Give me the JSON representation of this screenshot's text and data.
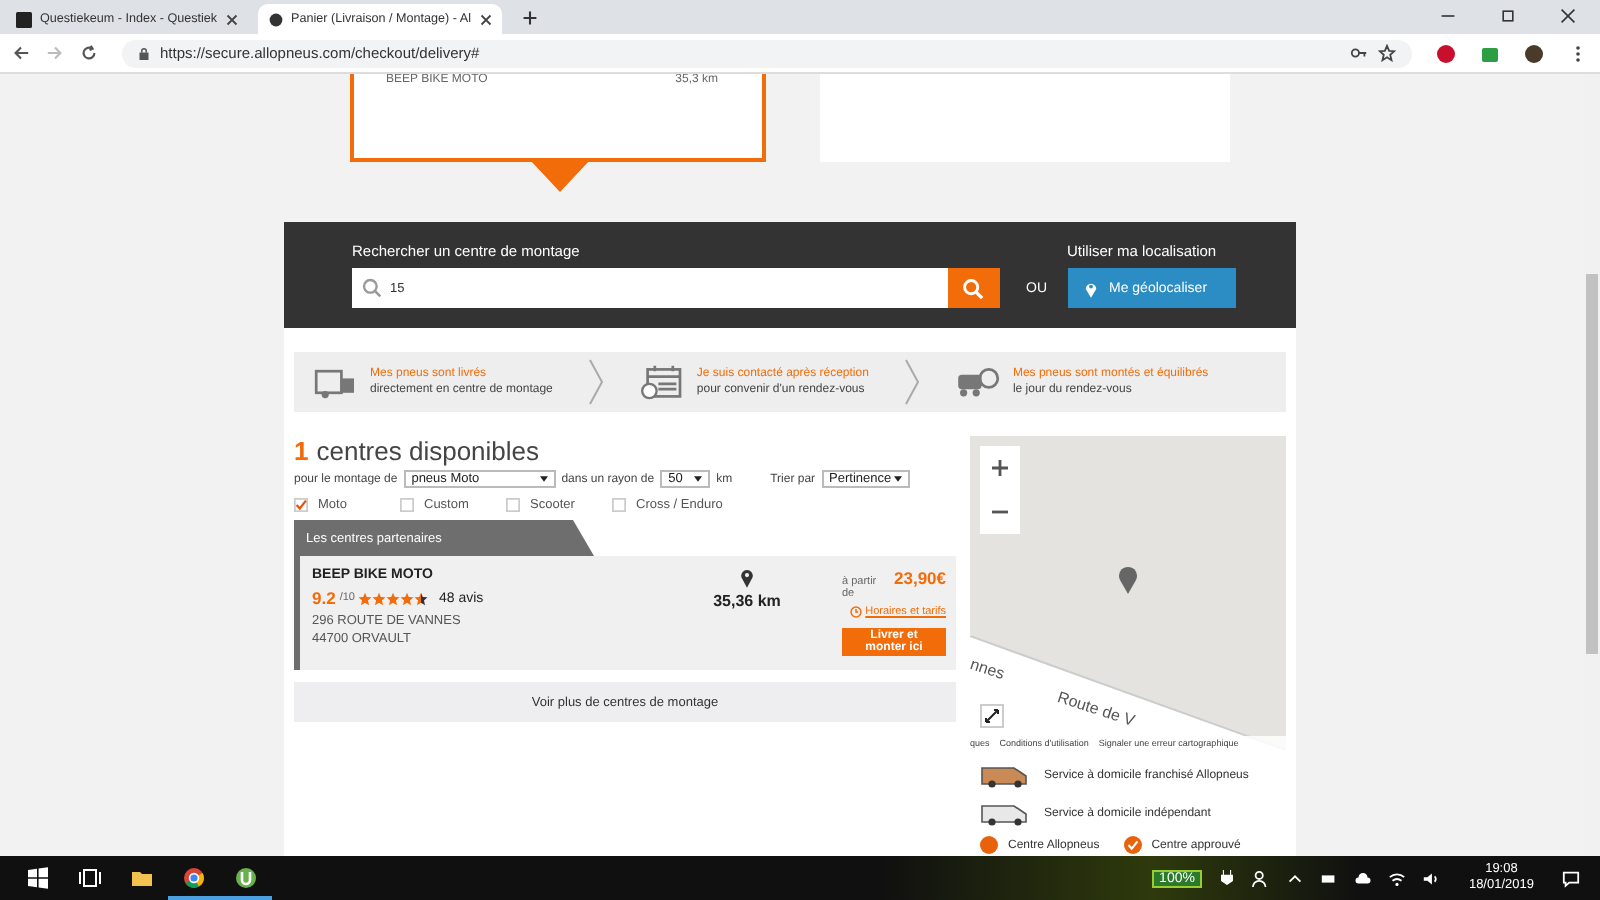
{
  "browser": {
    "tabs": [
      {
        "title": "Questiekeum - Index - Questiek",
        "selected": false
      },
      {
        "title": "Panier (Livraison / Montage) - Al",
        "selected": true
      }
    ],
    "url": "https://secure.allopneus.com/checkout/delivery#"
  },
  "top_card": {
    "name": "BEEP BIKE MOTO",
    "distance": "35,3 km"
  },
  "search": {
    "label": "Rechercher un centre de montage",
    "value": "15",
    "or_label": "OU",
    "geoloc_label": "Utiliser ma localisation",
    "geoloc_button": "Me géolocaliser"
  },
  "steps": [
    {
      "title": "Mes pneus sont livrés",
      "subtitle": "directement en centre de montage",
      "kind": "delivery"
    },
    {
      "title": "Je suis contacté après réception",
      "subtitle": "pour convenir d'un rendez-vous",
      "kind": "calendar"
    },
    {
      "title": "Mes pneus sont montés et équilibrés",
      "subtitle": "le jour du rendez-vous",
      "kind": "car"
    }
  ],
  "results": {
    "count": "1",
    "heading": "centres disponibles"
  },
  "filters": {
    "mount_label": "pour le montage de",
    "mount_value": "pneus Moto",
    "radius_label": "dans un rayon de",
    "radius_value": "50",
    "unit": "km",
    "sort_label": "Trier par",
    "sort_value": "Pertinence"
  },
  "categories": [
    {
      "label": "Moto",
      "checked": true
    },
    {
      "label": "Custom",
      "checked": false
    },
    {
      "label": "Scooter",
      "checked": false
    },
    {
      "label": "Cross / Enduro",
      "checked": false
    }
  ],
  "partners_tab": "Les centres partenaires",
  "centers": [
    {
      "name": "BEEP BIKE MOTO",
      "score": "9.2",
      "scale": "/10",
      "stars": 4.5,
      "reviews": "48 avis",
      "address": [
        "296 ROUTE DE VANNES",
        "44700 ORVAULT"
      ],
      "distance": "35,36 km",
      "price_prefix": "à partir de",
      "price": "23,90€",
      "hours_link": "Horaires et tarifs",
      "button": "Livrer et monter ici"
    }
  ],
  "more_button": "Voir plus de centres de montage",
  "map": {
    "road_labels": [
      "nnes",
      "Route de V"
    ],
    "footer": [
      "ques",
      "Conditions d'utilisation",
      "Signaler une erreur cartographique"
    ]
  },
  "legend": [
    {
      "label": "Service à domicile franchisé Allopneus",
      "kind": "franchise_van"
    },
    {
      "label": "Service à domicile indépendant",
      "kind": "van"
    }
  ],
  "legend_row": [
    {
      "label": "Centre Allopneus",
      "kind": "dot"
    },
    {
      "label": "Centre approuvé",
      "kind": "check"
    }
  ],
  "taskbar": {
    "battery": "100%",
    "time": "19:08",
    "date": "18/01/2019"
  }
}
